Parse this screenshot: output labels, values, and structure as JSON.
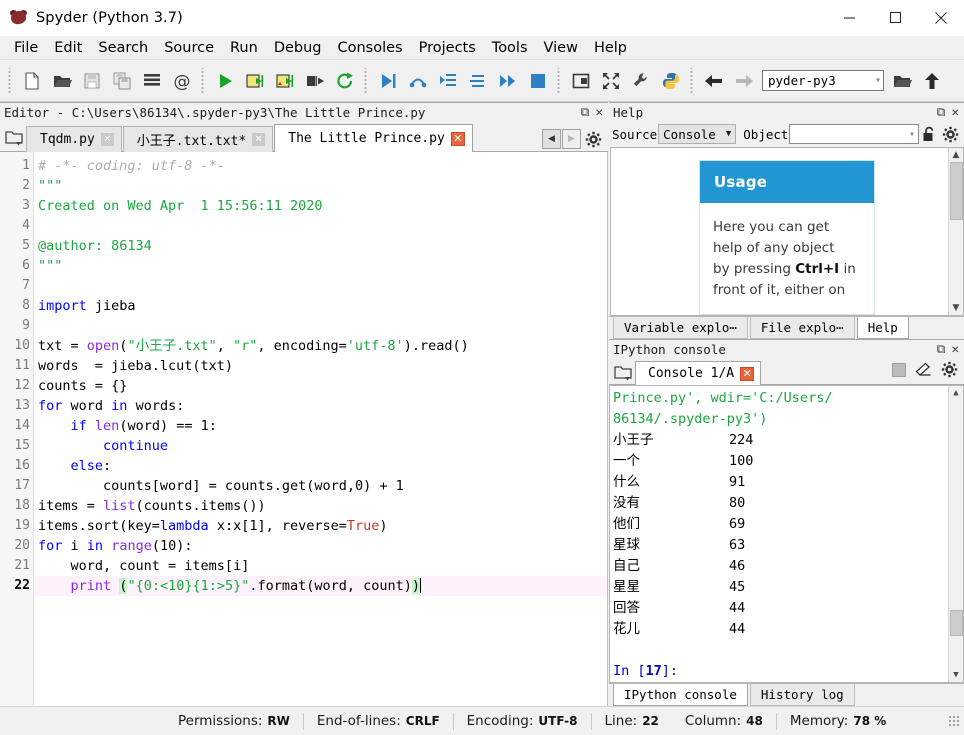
{
  "window": {
    "title": "Spyder (Python 3.7)",
    "icon": "spyder-logo-icon",
    "minimize": "—",
    "maximize": "☐",
    "close": "✕"
  },
  "menubar": {
    "items": [
      {
        "label": "File"
      },
      {
        "label": "Edit"
      },
      {
        "label": "Search"
      },
      {
        "label": "Source"
      },
      {
        "label": "Run"
      },
      {
        "label": "Debug"
      },
      {
        "label": "Consoles"
      },
      {
        "label": "Projects"
      },
      {
        "label": "Tools"
      },
      {
        "label": "View"
      },
      {
        "label": "Help"
      }
    ]
  },
  "toolbar": {
    "groups": [
      {
        "buttons": [
          {
            "name": "new-file-icon"
          },
          {
            "name": "open-file-icon"
          },
          {
            "name": "save-file-icon"
          },
          {
            "name": "save-all-icon"
          },
          {
            "name": "file-switcher-icon"
          },
          {
            "name": "find-symbol-icon"
          }
        ]
      },
      {
        "buttons": [
          {
            "name": "run-file-icon"
          },
          {
            "name": "run-cell-icon"
          },
          {
            "name": "run-cell-advance-icon"
          },
          {
            "name": "run-selection-icon"
          },
          {
            "name": "re-run-cell-icon"
          }
        ]
      },
      {
        "buttons": [
          {
            "name": "debug-file-icon"
          },
          {
            "name": "step-over-icon"
          },
          {
            "name": "step-into-icon"
          },
          {
            "name": "step-return-icon"
          },
          {
            "name": "continue-icon"
          },
          {
            "name": "stop-debug-icon"
          }
        ]
      },
      {
        "buttons": [
          {
            "name": "maximize-pane-icon"
          },
          {
            "name": "fullscreen-icon"
          },
          {
            "name": "preferences-icon"
          },
          {
            "name": "pythonpath-manager-icon"
          }
        ]
      },
      {
        "buttons": [
          {
            "name": "back-icon"
          },
          {
            "name": "forward-icon"
          }
        ]
      }
    ],
    "env_value": "pyder-py3",
    "after_env_buttons": [
      {
        "name": "browse-working-directory-icon"
      },
      {
        "name": "parent-directory-icon"
      }
    ]
  },
  "editor": {
    "pane_title": "Editor - C:\\Users\\86134\\.spyder-py3\\The Little Prince.py",
    "pane_tools": [
      {
        "name": "undock-pane-icon",
        "glyph": "⧉"
      },
      {
        "name": "close-pane-icon",
        "glyph": "✕"
      }
    ],
    "browse_tabs_icon": "browse-tabs-icon",
    "tabs": [
      {
        "label": "Tqdm.py",
        "active": false,
        "modified": false
      },
      {
        "label": "小王子.txt.txt*",
        "active": false,
        "modified": true
      },
      {
        "label": "The Little Prince.py",
        "active": true,
        "modified": false
      }
    ],
    "tab_nav": [
      {
        "name": "tab-scroll-left",
        "glyph": "◀",
        "enabled": true
      },
      {
        "name": "tab-scroll-right",
        "glyph": "▶",
        "enabled": false
      }
    ],
    "options_icon": "editor-options-gear-icon",
    "current_line": 22,
    "lines": [
      {
        "n": 1,
        "tokens": [
          {
            "t": "# -*- coding: utf-8 -*-",
            "c": "c-com"
          }
        ]
      },
      {
        "n": 2,
        "tokens": [
          {
            "t": "\"\"\"",
            "c": "c-str"
          }
        ]
      },
      {
        "n": 3,
        "tokens": [
          {
            "t": "Created on Wed Apr  1 15:56:11 2020",
            "c": "c-str"
          }
        ]
      },
      {
        "n": 4,
        "tokens": [
          {
            "t": "",
            "c": "c-def"
          }
        ]
      },
      {
        "n": 5,
        "tokens": [
          {
            "t": "@author: 86134",
            "c": "c-str"
          }
        ]
      },
      {
        "n": 6,
        "tokens": [
          {
            "t": "\"\"\"",
            "c": "c-str"
          }
        ]
      },
      {
        "n": 7,
        "tokens": [
          {
            "t": "",
            "c": "c-def"
          }
        ]
      },
      {
        "n": 8,
        "tokens": [
          {
            "t": "import",
            "c": "c-kw"
          },
          {
            "t": " jieba",
            "c": "c-def"
          }
        ]
      },
      {
        "n": 9,
        "tokens": [
          {
            "t": "",
            "c": "c-def"
          }
        ]
      },
      {
        "n": 10,
        "tokens": [
          {
            "t": "txt = ",
            "c": "c-def"
          },
          {
            "t": "open",
            "c": "c-bi"
          },
          {
            "t": "(",
            "c": "c-def"
          },
          {
            "t": "\"小王子.txt\"",
            "c": "c-str"
          },
          {
            "t": ", ",
            "c": "c-def"
          },
          {
            "t": "\"r\"",
            "c": "c-str"
          },
          {
            "t": ", encoding=",
            "c": "c-def"
          },
          {
            "t": "'utf-8'",
            "c": "c-str"
          },
          {
            "t": ").read()",
            "c": "c-def"
          }
        ]
      },
      {
        "n": 11,
        "tokens": [
          {
            "t": "words  = jieba.lcut(txt)",
            "c": "c-def"
          }
        ]
      },
      {
        "n": 12,
        "tokens": [
          {
            "t": "counts = {}",
            "c": "c-def"
          }
        ]
      },
      {
        "n": 13,
        "tokens": [
          {
            "t": "for",
            "c": "c-kw"
          },
          {
            "t": " word ",
            "c": "c-def"
          },
          {
            "t": "in",
            "c": "c-kw"
          },
          {
            "t": " words:",
            "c": "c-def"
          }
        ]
      },
      {
        "n": 14,
        "tokens": [
          {
            "t": "    ",
            "c": "c-def"
          },
          {
            "t": "if",
            "c": "c-kw"
          },
          {
            "t": " ",
            "c": "c-def"
          },
          {
            "t": "len",
            "c": "c-bi"
          },
          {
            "t": "(word) == ",
            "c": "c-def"
          },
          {
            "t": "1",
            "c": "c-num"
          },
          {
            "t": ":",
            "c": "c-def"
          }
        ]
      },
      {
        "n": 15,
        "tokens": [
          {
            "t": "        ",
            "c": "c-def"
          },
          {
            "t": "continue",
            "c": "c-kw"
          }
        ]
      },
      {
        "n": 16,
        "tokens": [
          {
            "t": "    ",
            "c": "c-def"
          },
          {
            "t": "else",
            "c": "c-kw"
          },
          {
            "t": ":",
            "c": "c-def"
          }
        ]
      },
      {
        "n": 17,
        "tokens": [
          {
            "t": "        counts[word] = counts.get(word,",
            "c": "c-def"
          },
          {
            "t": "0",
            "c": "c-num"
          },
          {
            "t": ") + ",
            "c": "c-def"
          },
          {
            "t": "1",
            "c": "c-num"
          }
        ]
      },
      {
        "n": 18,
        "tokens": [
          {
            "t": "items = ",
            "c": "c-def"
          },
          {
            "t": "list",
            "c": "c-bi"
          },
          {
            "t": "(counts.items())",
            "c": "c-def"
          }
        ]
      },
      {
        "n": 19,
        "tokens": [
          {
            "t": "items.sort(key=",
            "c": "c-def"
          },
          {
            "t": "lambda",
            "c": "c-kw"
          },
          {
            "t": " x:x[",
            "c": "c-def"
          },
          {
            "t": "1",
            "c": "c-num"
          },
          {
            "t": "], reverse=",
            "c": "c-def"
          },
          {
            "t": "True",
            "c": "c-cn"
          },
          {
            "t": ")",
            "c": "c-def"
          }
        ]
      },
      {
        "n": 20,
        "tokens": [
          {
            "t": "for",
            "c": "c-kw"
          },
          {
            "t": " i ",
            "c": "c-def"
          },
          {
            "t": "in",
            "c": "c-kw"
          },
          {
            "t": " ",
            "c": "c-def"
          },
          {
            "t": "range",
            "c": "c-bi"
          },
          {
            "t": "(",
            "c": "c-def"
          },
          {
            "t": "10",
            "c": "c-num"
          },
          {
            "t": "):",
            "c": "c-def"
          }
        ]
      },
      {
        "n": 21,
        "tokens": [
          {
            "t": "    word, count = items[i]",
            "c": "c-def"
          }
        ]
      },
      {
        "n": 22,
        "tokens": [
          {
            "t": "    ",
            "c": "c-def"
          },
          {
            "t": "print",
            "c": "c-bi"
          },
          {
            "t": " ",
            "c": "c-def"
          },
          {
            "t": "(",
            "c": "hl-paren"
          },
          {
            "t": "\"{0:<10}{1:>5}\"",
            "c": "c-str"
          },
          {
            "t": ".format(word, count)",
            "c": "c-def"
          },
          {
            "t": ")",
            "c": "hl-paren"
          }
        ]
      }
    ]
  },
  "help": {
    "pane_title": "Help",
    "pane_tools": [
      {
        "name": "undock-pane-icon",
        "glyph": "⧉"
      },
      {
        "name": "close-pane-icon",
        "glyph": "✕"
      }
    ],
    "source_label": "Source",
    "source_value": "Console",
    "object_label": "Object",
    "object_value": "",
    "lock_icon": "lock-open-icon",
    "options_icon": "help-options-gear-icon",
    "usage_title": "Usage",
    "usage_text_1": "Here you can get",
    "usage_text_2": "help of any object",
    "usage_text_3a": "by pressing ",
    "usage_text_3b": "Ctrl+I",
    "usage_text_3c": " in",
    "usage_text_4": "front of it, either on"
  },
  "bottom_tabs_help": {
    "items": [
      {
        "label": "Variable explo⋯",
        "active": false
      },
      {
        "label": "File explo⋯",
        "active": false
      },
      {
        "label": "Help",
        "active": true
      }
    ]
  },
  "console": {
    "pane_title": "IPython console",
    "pane_tools": [
      {
        "name": "undock-pane-icon",
        "glyph": "⧉"
      },
      {
        "name": "close-pane-icon",
        "glyph": "✕"
      }
    ],
    "browse_tabs_icon": "browse-console-tabs-icon",
    "tab_label": "Console 1/A",
    "tools": [
      {
        "name": "stop-kernel-icon"
      },
      {
        "name": "clear-console-icon"
      },
      {
        "name": "console-options-gear-icon"
      }
    ],
    "output": [
      {
        "type": "green",
        "text": "Prince.py', wdir='C:/Users/"
      },
      {
        "type": "green",
        "text": "86134/.spyder-py3')"
      },
      {
        "type": "row",
        "word": "小王子",
        "count": "224"
      },
      {
        "type": "row",
        "word": "一个",
        "count": "100"
      },
      {
        "type": "row",
        "word": "什么",
        "count": "91"
      },
      {
        "type": "row",
        "word": "没有",
        "count": "80"
      },
      {
        "type": "row",
        "word": "他们",
        "count": "69"
      },
      {
        "type": "row",
        "word": "星球",
        "count": "63"
      },
      {
        "type": "row",
        "word": "自己",
        "count": "46"
      },
      {
        "type": "row",
        "word": "星星",
        "count": "45"
      },
      {
        "type": "row",
        "word": "回答",
        "count": "44"
      },
      {
        "type": "row",
        "word": "花儿",
        "count": "44"
      },
      {
        "type": "blank",
        "text": ""
      },
      {
        "type": "prompt",
        "pre": "In [",
        "num": "17",
        "post": "]:"
      }
    ]
  },
  "bottom_tabs_console": {
    "items": [
      {
        "label": "IPython console",
        "active": true
      },
      {
        "label": "History log",
        "active": false
      }
    ]
  },
  "statusbar": {
    "items": [
      {
        "key": "Permissions:",
        "value": "RW"
      },
      {
        "key": "End-of-lines:",
        "value": "CRLF"
      },
      {
        "key": "Encoding:",
        "value": "UTF-8"
      },
      {
        "key": "Line:",
        "value": "22"
      },
      {
        "key": "Column:",
        "value": "48"
      },
      {
        "key": "Memory:",
        "value": "78 %"
      }
    ]
  },
  "colors": {
    "accent_blue": "#2196d3",
    "tab_close_red": "#e8643c",
    "string_green": "#1aa83f",
    "keyword_blue": "#0000ff",
    "builtin_purple": "#8a2be2",
    "comment_grey": "#adadad",
    "current_line_pink": "#fdf2fb",
    "chrome_grey": "#f0f0f0"
  }
}
